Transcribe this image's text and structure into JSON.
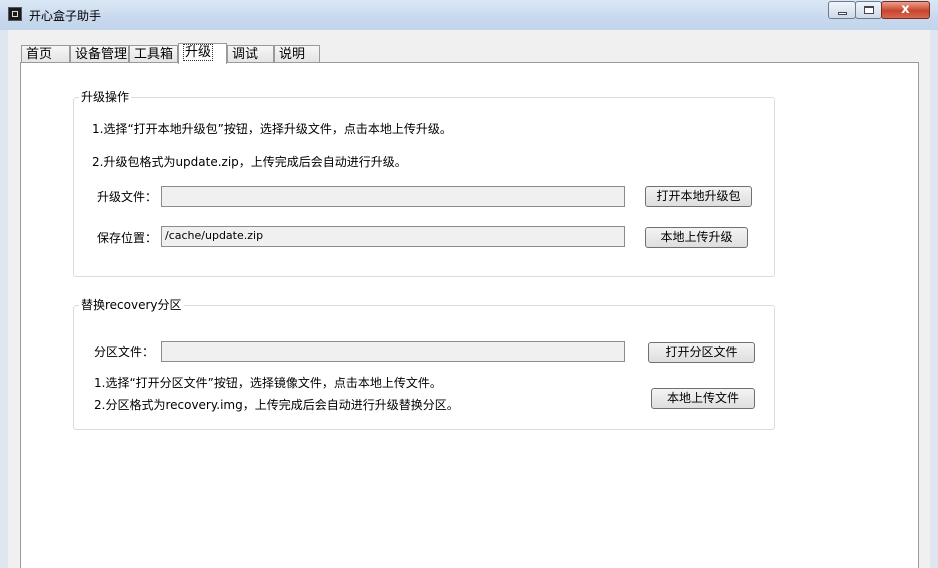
{
  "window": {
    "title": "开心盒子助手",
    "close_glyph": "x"
  },
  "tabs": [
    "首页",
    "设备管理",
    "工具箱",
    "升级",
    "调试",
    "说明"
  ],
  "active_tab_index": 3,
  "upgrade_group": {
    "title": "升级操作",
    "instruction1": "1.选择“打开本地升级包”按钮，选择升级文件，点击本地上传升级。",
    "instruction2": "2.升级包格式为update.zip，上传完成后会自动进行升级。",
    "file_label": "升级文件：",
    "file_value": "",
    "path_label": "保存位置：",
    "path_value": "/cache/update.zip",
    "open_button": "打开本地升级包",
    "upload_button": "本地上传升级"
  },
  "recovery_group": {
    "title": "替换recovery分区",
    "file_label": "分区文件：",
    "file_value": "",
    "open_button": "打开分区文件",
    "upload_button": "本地上传文件",
    "instruction1": "1.选择“打开分区文件”按钮，选择镜像文件，点击本地上传文件。",
    "instruction2": "2.分区格式为recovery.img，上传完成后会自动进行升级替换分区。"
  }
}
